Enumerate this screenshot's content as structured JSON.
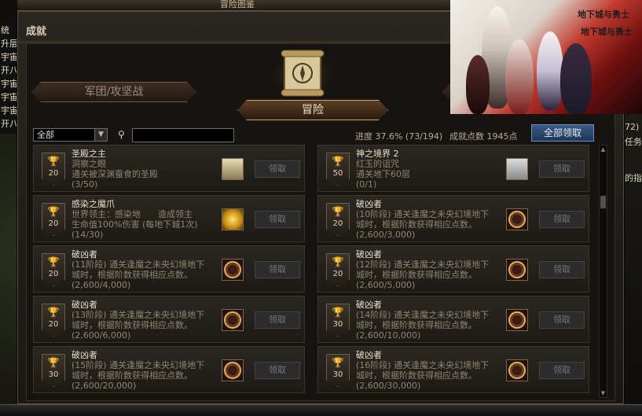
{
  "window": {
    "title": "冒险图鉴",
    "section_title": "成就"
  },
  "left_strip": [
    "统",
    "升层",
    "宇宙",
    "开八",
    "宇宙",
    "宇宙",
    "宇宙",
    "开八"
  ],
  "right_edge": [
    "72)",
    "任务",
    "的指"
  ],
  "tabs": {
    "left": "军团/攻坚战",
    "active": "冒险"
  },
  "filter": {
    "category": "全部"
  },
  "progress": "进度 37.6% (73/194)",
  "points": "成就点数 1945点",
  "claim_all": "全部领取",
  "claim_label": "领取",
  "hero_logo": "地下城与勇士",
  "cards": [
    {
      "points": "20",
      "name": "圣殿之主",
      "desc": "洞察之眼\n通关被深渊蚕食的圣殿",
      "progress": "(3/50)",
      "icon": "chest-icon",
      "cup": "silver"
    },
    {
      "points": "50",
      "name": "神之境界 2",
      "desc": "红玉的诅咒\n通关地下60层",
      "progress": "(0/1)",
      "icon": "scroll-icon",
      "cup": "gold"
    },
    {
      "points": "20",
      "name": "感染之魔爪",
      "desc": "世界领主：感染地　　造成领主\n生命值100%伤害 (每地下城1次)",
      "progress": "(14/30)",
      "icon": "star-icon",
      "cup": "silver"
    },
    {
      "points": "20",
      "name": "破凶者",
      "desc": "(10阶段) 通关逢魔之未央幻境地下\n城时，根据阶数获得相应点数。",
      "progress": "(2,600/3,000)",
      "icon": "emblem-icon",
      "cup": "silver"
    },
    {
      "points": "20",
      "name": "破凶者",
      "desc": "(11阶段) 通关逢魔之未央幻境地下\n城时，根据阶数获得相应点数。",
      "progress": "(2,600/4,000)",
      "icon": "emblem-icon",
      "cup": "silver"
    },
    {
      "points": "20",
      "name": "破凶者",
      "desc": "(12阶段) 通关逢魔之未央幻境地下\n城时，根据阶数获得相应点数。",
      "progress": "(2,600/5,000)",
      "icon": "emblem-icon",
      "cup": "silver"
    },
    {
      "points": "20",
      "name": "破凶者",
      "desc": "(13阶段) 通关逢魔之未央幻境地下\n城时，根据阶数获得相应点数。",
      "progress": "(2,600/6,000)",
      "icon": "emblem-icon",
      "cup": "silver"
    },
    {
      "points": "30",
      "name": "破凶者",
      "desc": "(14阶段) 通关逢魔之未央幻境地下\n城时，根据阶数获得相应点数。",
      "progress": "(2,600/10,000)",
      "icon": "emblem-icon",
      "cup": "silver"
    },
    {
      "points": "30",
      "name": "破凶者",
      "desc": "(15阶段) 通关逢魔之未央幻境地下\n城时，根据阶数获得相应点数。",
      "progress": "(2,600/20,000)",
      "icon": "emblem-icon",
      "cup": "silver"
    },
    {
      "points": "30",
      "name": "破凶者",
      "desc": "(16阶段) 通关逢魔之未央幻境地下\n城时，根据阶数获得相应点数。",
      "progress": "(2,600/30,000)",
      "icon": "emblem-icon",
      "cup": "silver"
    }
  ]
}
